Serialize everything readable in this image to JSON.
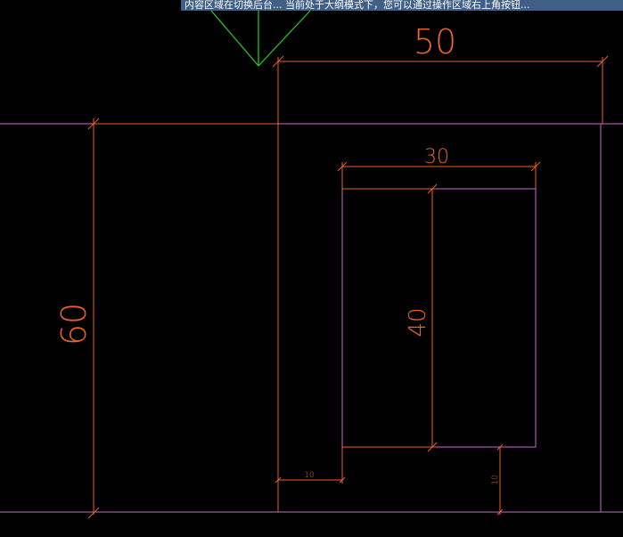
{
  "banner": {
    "text": "内容区域在切换后台... 当前处于大纲模式下，您可以通过操作区域右上角按钮..."
  },
  "dimensions": {
    "overall_width": "50",
    "overall_height": "60",
    "window_width": "30",
    "window_height": "40",
    "left_offset": "10",
    "bottom_offset": "10"
  },
  "colors": {
    "dimension": "#e8622b",
    "outline": "#c86ad0",
    "marker": "#22d41e",
    "background": "#000000"
  }
}
